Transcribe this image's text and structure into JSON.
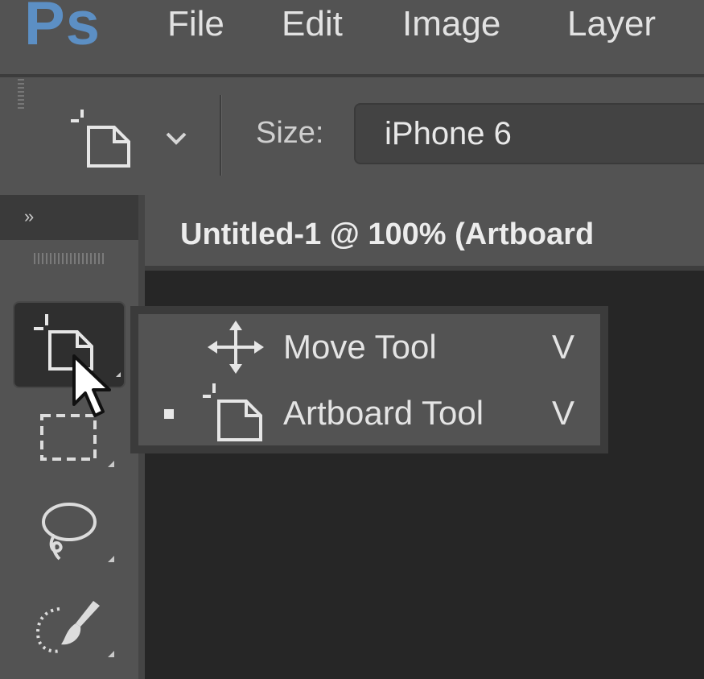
{
  "app": {
    "logo": "Ps",
    "accent_color": "#5c8fc4"
  },
  "menubar": {
    "items": [
      {
        "label": "File"
      },
      {
        "label": "Edit"
      },
      {
        "label": "Image"
      },
      {
        "label": "Layer"
      }
    ]
  },
  "options_bar": {
    "tool_icon": "artboard-icon",
    "dropdown_icon": "chevron-down-icon",
    "size_label": "Size:",
    "size_value": "iPhone 6"
  },
  "tools_panel": {
    "collapse_glyph": "»",
    "tools": [
      {
        "icon": "artboard-tool-icon",
        "active": true
      },
      {
        "icon": "rectangular-marquee-icon",
        "active": false
      },
      {
        "icon": "lasso-icon",
        "active": false
      },
      {
        "icon": "quick-selection-icon",
        "active": false
      }
    ]
  },
  "document": {
    "tab_title": "Untitled-1 @ 100% (Artboard"
  },
  "tool_flyout": {
    "items": [
      {
        "icon": "move-icon",
        "label": "Move Tool",
        "shortcut": "V",
        "selected": false
      },
      {
        "icon": "artboard-icon",
        "label": "Artboard Tool",
        "shortcut": "V",
        "selected": true
      }
    ]
  }
}
